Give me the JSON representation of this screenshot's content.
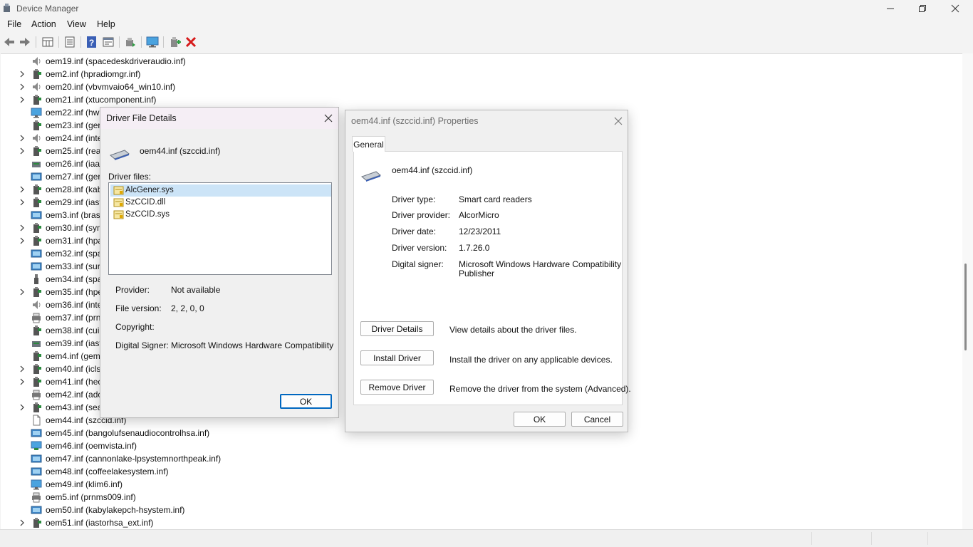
{
  "window": {
    "title": "Device Manager"
  },
  "menu": [
    "File",
    "Action",
    "View",
    "Help"
  ],
  "toolbar_icons": [
    "back-icon",
    "forward-icon",
    "properties-grid-icon",
    "list-icon",
    "help-icon",
    "console-icon",
    "update-driver-icon",
    "monitor-icon",
    "add-driver-icon",
    "uninstall-icon"
  ],
  "tree": [
    {
      "label": "oem19.inf (spacedeskdriveraudio.inf)",
      "icon": "speaker-icon",
      "expandable": false
    },
    {
      "label": "oem2.inf (hpradiomgr.inf)",
      "icon": "hid-device-icon",
      "expandable": true
    },
    {
      "label": "oem20.inf (vbvmvaio64_win10.inf)",
      "icon": "speaker-icon",
      "expandable": true
    },
    {
      "label": "oem21.inf (xtucomponent.inf)",
      "icon": "hid-device-icon",
      "expandable": true
    },
    {
      "label": "oem22.inf (hw",
      "icon": "monitor-icon",
      "expandable": false
    },
    {
      "label": "oem23.inf (ger",
      "icon": "hid-device-icon",
      "expandable": false
    },
    {
      "label": "oem24.inf (inte",
      "icon": "speaker-icon",
      "expandable": true
    },
    {
      "label": "oem25.inf (rea",
      "icon": "hid-device-icon",
      "expandable": true
    },
    {
      "label": "oem26.inf (iaa",
      "icon": "storage-icon",
      "expandable": false
    },
    {
      "label": "oem27.inf (ger",
      "icon": "system-device-icon",
      "expandable": false
    },
    {
      "label": "oem28.inf (kab",
      "icon": "hid-device-icon",
      "expandable": true
    },
    {
      "label": "oem29.inf (iast",
      "icon": "hid-device-icon",
      "expandable": true
    },
    {
      "label": "oem3.inf (bras",
      "icon": "system-device-icon",
      "expandable": false
    },
    {
      "label": "oem30.inf (syn",
      "icon": "hid-device-icon",
      "expandable": true
    },
    {
      "label": "oem31.inf (hpa",
      "icon": "hid-device-icon",
      "expandable": true
    },
    {
      "label": "oem32.inf (spa",
      "icon": "system-device-icon",
      "expandable": false
    },
    {
      "label": "oem33.inf (sur",
      "icon": "system-device-icon",
      "expandable": false
    },
    {
      "label": "oem34.inf (spa",
      "icon": "usb-icon",
      "expandable": false
    },
    {
      "label": "oem35.inf (hpe",
      "icon": "hid-device-icon",
      "expandable": true
    },
    {
      "label": "oem36.inf (inte",
      "icon": "speaker-icon",
      "expandable": false
    },
    {
      "label": "oem37.inf (prn",
      "icon": "printer-icon",
      "expandable": false
    },
    {
      "label": "oem38.inf (cui",
      "icon": "hid-device-icon",
      "expandable": false
    },
    {
      "label": "oem39.inf (iast",
      "icon": "storage-icon",
      "expandable": false
    },
    {
      "label": "oem4.inf (gem",
      "icon": "hid-device-icon",
      "expandable": false
    },
    {
      "label": "oem40.inf (icls",
      "icon": "hid-device-icon",
      "expandable": true
    },
    {
      "label": "oem41.inf (hec",
      "icon": "hid-device-icon",
      "expandable": true
    },
    {
      "label": "oem42.inf (adc",
      "icon": "printer-icon",
      "expandable": false
    },
    {
      "label": "oem43.inf (sea",
      "icon": "hid-device-icon",
      "expandable": true
    },
    {
      "label": "oem44.inf (szccid.inf)",
      "icon": "document-icon",
      "expandable": false
    },
    {
      "label": "oem45.inf (bangolufsenaudiocontrolhsa.inf)",
      "icon": "system-device-icon",
      "expandable": false
    },
    {
      "label": "oem46.inf (oemvista.inf)",
      "icon": "network-icon",
      "expandable": false
    },
    {
      "label": "oem47.inf (cannonlake-lpsystemnorthpeak.inf)",
      "icon": "system-device-icon",
      "expandable": false
    },
    {
      "label": "oem48.inf (coffeelakesystem.inf)",
      "icon": "system-device-icon",
      "expandable": false
    },
    {
      "label": "oem49.inf (klim6.inf)",
      "icon": "monitor-icon",
      "expandable": false
    },
    {
      "label": "oem5.inf (prnms009.inf)",
      "icon": "printer-icon",
      "expandable": false
    },
    {
      "label": "oem50.inf (kabylakepch-hsystem.inf)",
      "icon": "system-device-icon",
      "expandable": false
    },
    {
      "label": "oem51.inf (iastorhsa_ext.inf)",
      "icon": "hid-device-icon",
      "expandable": true
    }
  ],
  "file_details_dialog": {
    "title": "Driver File Details",
    "name": "oem44.inf (szccid.inf)",
    "files_label": "Driver files:",
    "files": [
      "AlcGener.sys",
      "SzCCID.dll",
      "SzCCID.sys"
    ],
    "selected_file_index": 0,
    "provider_label": "Provider:",
    "provider_value": "Not available",
    "version_label": "File version:",
    "version_value": "2, 2, 0, 0",
    "copyright_label": "Copyright:",
    "copyright_value": "",
    "signer_label": "Digital Signer:",
    "signer_value": "Microsoft Windows Hardware Compatibility",
    "ok_label": "OK"
  },
  "properties_dialog": {
    "title": "oem44.inf (szccid.inf) Properties",
    "tab": "General",
    "name": "oem44.inf (szccid.inf)",
    "type_label": "Driver type:",
    "type_value": "Smart card readers",
    "provider_label": "Driver provider:",
    "provider_value": "AlcorMicro",
    "date_label": "Driver date:",
    "date_value": "12/23/2011",
    "version_label": "Driver version:",
    "version_value": "1.7.26.0",
    "signer_label": "Digital signer:",
    "signer_value_1": "Microsoft Windows Hardware Compatibility",
    "signer_value_2": "Publisher",
    "details_btn": "Driver Details",
    "details_desc": "View details about the driver files.",
    "install_btn": "Install Driver",
    "install_desc": "Install the driver on any applicable devices.",
    "remove_btn": "Remove Driver",
    "remove_desc": "Remove the driver from the system (Advanced).",
    "ok_label": "OK",
    "cancel_label": "Cancel"
  }
}
